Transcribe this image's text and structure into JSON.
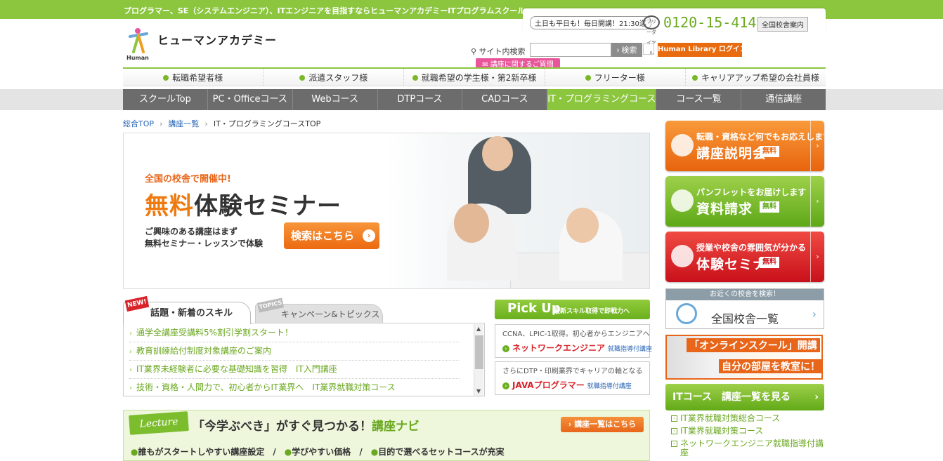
{
  "topbar": {
    "tagline": "プログラマー、SE（システムエンジニア）、ITエンジニアを目指すならヒューマンアカデミーITプログラムスクール"
  },
  "contact": {
    "hours": "土日も平日も！毎日開講！21:30迄",
    "free_dial_label": "フリーダイヤル",
    "phone": "0120-15-4149",
    "campus_guide": "全国校舎案内"
  },
  "logo": {
    "text": "ヒューマンアカデミー",
    "sub": "Human"
  },
  "search": {
    "label": "サイト内検索",
    "placeholder": "",
    "button": "検索"
  },
  "header_links": {
    "human_library": "Human Library ログイン",
    "question": "講座に関するご質問"
  },
  "target_nav": [
    "転職希望者様",
    "派遣スタッフ様",
    "就職希望の学生様・第2新卒様",
    "フリーター様",
    "キャリアアップ希望の会社員様"
  ],
  "course_nav": {
    "items": [
      "スクールTop",
      "PC・Officeコース",
      "Webコース",
      "DTPコース",
      "CADコース",
      "IT・プログラミングコース",
      "コース一覧",
      "通信講座"
    ],
    "active_index": 5
  },
  "breadcrumb": {
    "items": [
      "総合TOP",
      "講座一覧"
    ],
    "current": "IT・プログラミングコースTOP"
  },
  "hero": {
    "sub": "全国の校舎で開催中!",
    "title_accent": "無料",
    "title_rest": "体験セミナー",
    "desc_line1": "ご興味のある講座はまず",
    "desc_line2": "無料セミナー・レッスンで体験",
    "button": "検索はこちら"
  },
  "news_tabs": {
    "new_badge": "NEW!",
    "tab1": "話題・新着のスキル",
    "topics_badge": "TOPICS",
    "tab2": "キャンペーン&トピックス"
  },
  "news": [
    "通学全講座受講料5%割引学割スタート！",
    "教育訓練給付制度対象講座のご案内",
    "IT業界未経験者に必要な基礎知識を習得　IT入門講座",
    "技術・資格・人間力で、初心者からIT業界へ　IT業界就職対策コース"
  ],
  "pickup": {
    "title": "Pick Up",
    "subtitle": "最新スキル取得で即戦力へ",
    "cards": [
      {
        "desc": "CCNA、LPIC-1取得。初心者からエンジニアへ",
        "name": "ネットワークエンジニア",
        "tag": "就職指導付講座"
      },
      {
        "desc": "さらにDTP・印刷業界でキャリアの軸となる",
        "name": "JAVAプログラマー",
        "tag": "就職指導付講座"
      }
    ]
  },
  "navi": {
    "lecture": "Lecture",
    "title_main": "「今学ぶべき」がすぐ見つかる！",
    "title_accent": "講座ナビ",
    "button": "講座一覧はこちら",
    "features": [
      "誰もがスタートしやすい講座設定",
      "学びやすい価格",
      "目的で選べるセットコースが充実"
    ],
    "separator": "/"
  },
  "sidebar": {
    "seminar": {
      "sub": "転職・資格など何でもお応えします",
      "main": "講座説明会",
      "tag": "無料"
    },
    "brochure": {
      "sub": "パンフレットをお届けします",
      "main": "資料請求",
      "tag": "無料"
    },
    "trial": {
      "sub": "授業や校舎の雰囲気が分かる",
      "main": "体験セミナー",
      "tag": "無料"
    },
    "campus_search": {
      "head": "お近くの校舎を検索！",
      "label": "全国校舎一覧"
    },
    "online": {
      "line1": "「オンラインスクール」開講",
      "line2": "自分の部屋を教室に！"
    },
    "it_courses": {
      "label": "ITコース　講座一覧を見る"
    },
    "it_list": [
      "IT業界就職対策総合コース",
      "IT業界就職対策コース",
      "ネットワークエンジニア就職指導付講座"
    ]
  },
  "colors": {
    "brand_green": "#8cc63f",
    "accent_orange": "#e8661a",
    "accent_red": "#d8232a",
    "link_blue": "#2664b5"
  }
}
